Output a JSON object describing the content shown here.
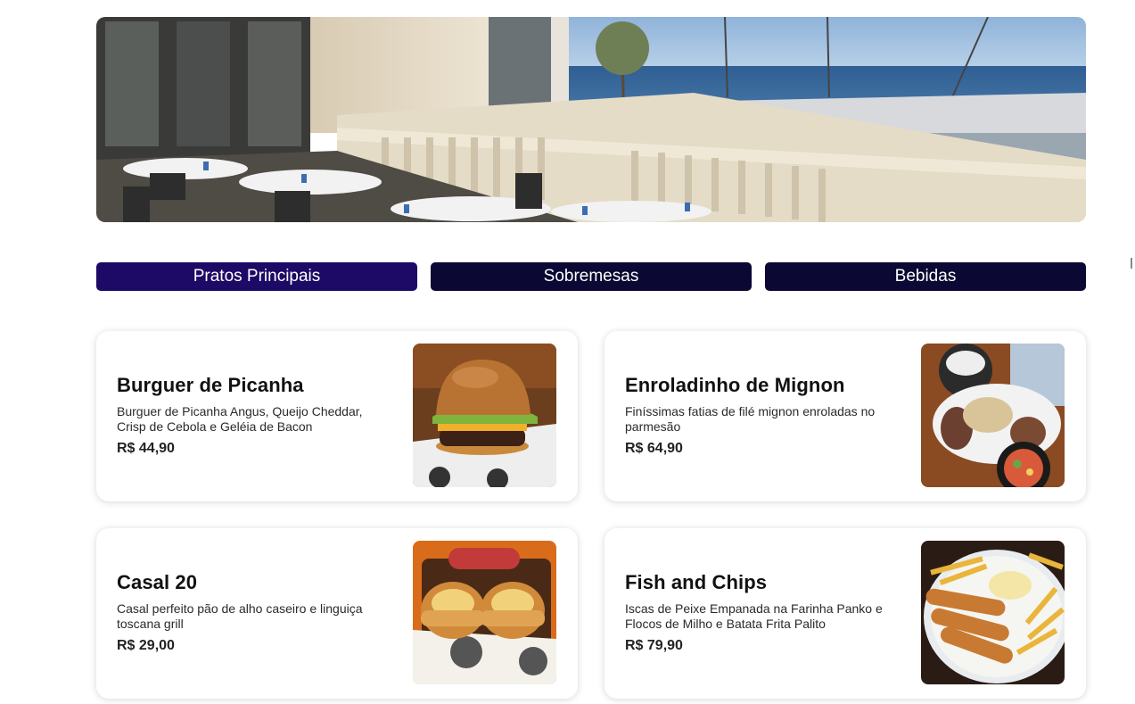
{
  "hero": {
    "image": "restaurant-terrace-sea-view"
  },
  "tabs": [
    {
      "label": "Pratos Principais",
      "active": true
    },
    {
      "label": "Sobremesas",
      "active": false
    },
    {
      "label": "Bebidas",
      "active": false
    }
  ],
  "menu_items": [
    {
      "name": "Burguer de Picanha",
      "description": "Burguer de Picanha Angus, Queijo Cheddar, Crisp de Cebola e Geléia de Bacon",
      "price": "R$ 44,90",
      "image": "burger-photo"
    },
    {
      "name": "Enroladinho de Mignon",
      "description": "Finíssimas fatias de filé mignon enroladas no parmesão",
      "price": "R$ 64,90",
      "image": "mignon-rolls-photo"
    },
    {
      "name": "Casal 20",
      "description": "Casal perfeito pão de alho caseiro e linguiça toscana grill",
      "price": "R$ 29,00",
      "image": "garlic-bread-sausage-photo"
    },
    {
      "name": "Fish and Chips",
      "description": "Iscas de Peixe Empanada na Farinha Panko e Flocos de Milho e Batata Frita Palito",
      "price": "R$ 79,90",
      "image": "fish-and-chips-photo"
    }
  ],
  "colors": {
    "tab_active": "#1d0a66",
    "tab_inactive": "#0b0833",
    "tab_text": "#ffffff"
  }
}
